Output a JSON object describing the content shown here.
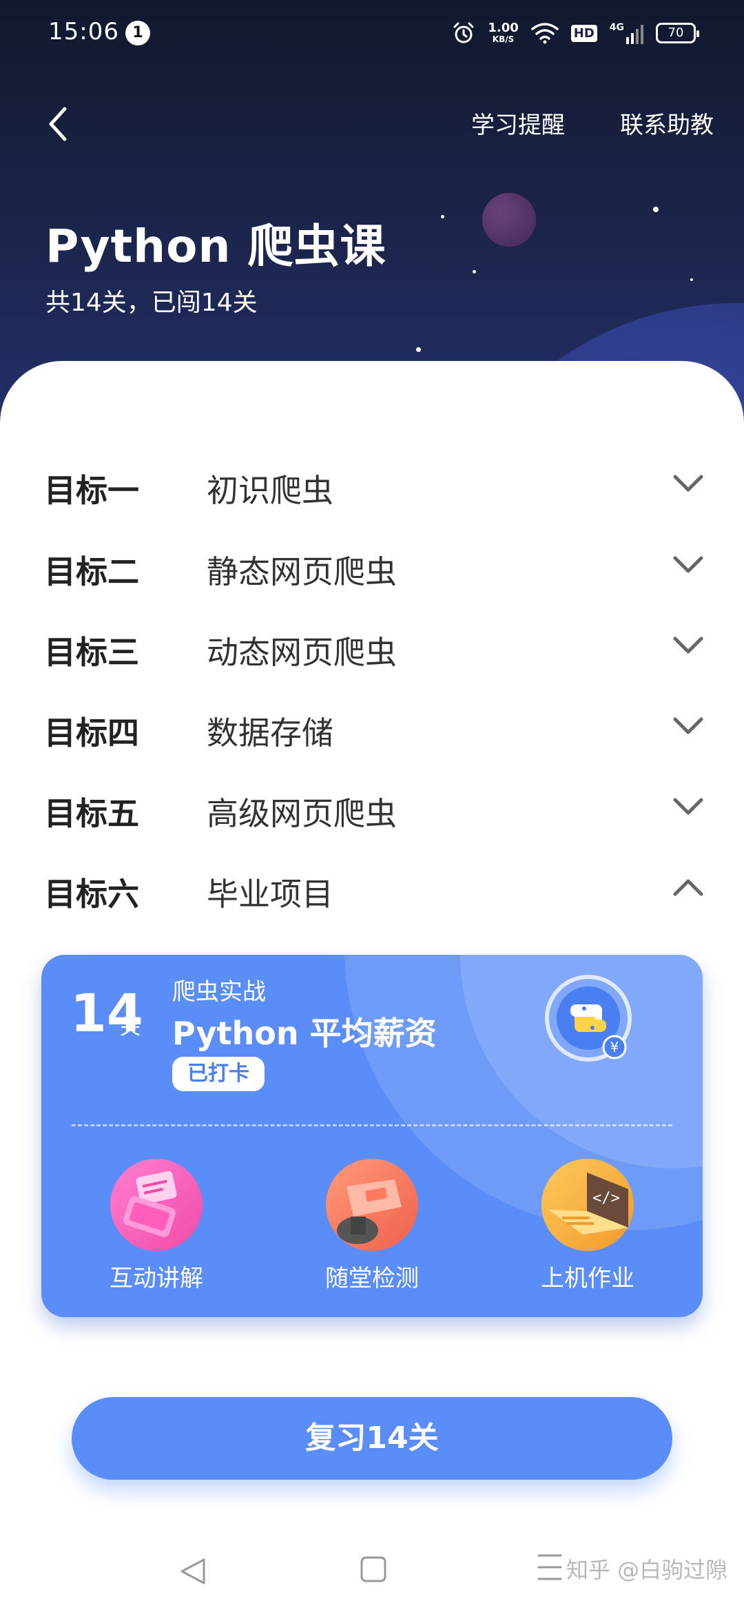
{
  "status_bar": {
    "time": "15:06",
    "notification_count": "1",
    "net_speed_value": "1.00",
    "net_speed_unit": "KB/S",
    "hd_label": "HD",
    "network_label": "4G",
    "battery": "70"
  },
  "nav": {
    "reminder_label": "学习提醒",
    "assistant_label": "联系助教"
  },
  "course": {
    "title": "Python 爬虫课",
    "subtitle": "共14关，已闯14关"
  },
  "goals": [
    {
      "label": "目标一",
      "name": "初识爬虫",
      "expanded": false
    },
    {
      "label": "目标二",
      "name": "静态网页爬虫",
      "expanded": false
    },
    {
      "label": "目标三",
      "name": "动态网页爬虫",
      "expanded": false
    },
    {
      "label": "目标四",
      "name": "数据存储",
      "expanded": false
    },
    {
      "label": "目标五",
      "name": "高级网页爬虫",
      "expanded": false
    },
    {
      "label": "目标六",
      "name": "毕业项目",
      "expanded": true
    }
  ],
  "project_card": {
    "level_number": "14",
    "level_unit": "关",
    "category": "爬虫实战",
    "title": "Python 平均薪资",
    "status_badge": "已打卡",
    "features": [
      {
        "label": "互动讲解"
      },
      {
        "label": "随堂检测"
      },
      {
        "label": "上机作业"
      }
    ]
  },
  "review_button": "复习14关",
  "watermark": "知乎 @白驹过隙",
  "colors": {
    "accent": "#5a8df7",
    "header_bg": "#1a2346"
  }
}
